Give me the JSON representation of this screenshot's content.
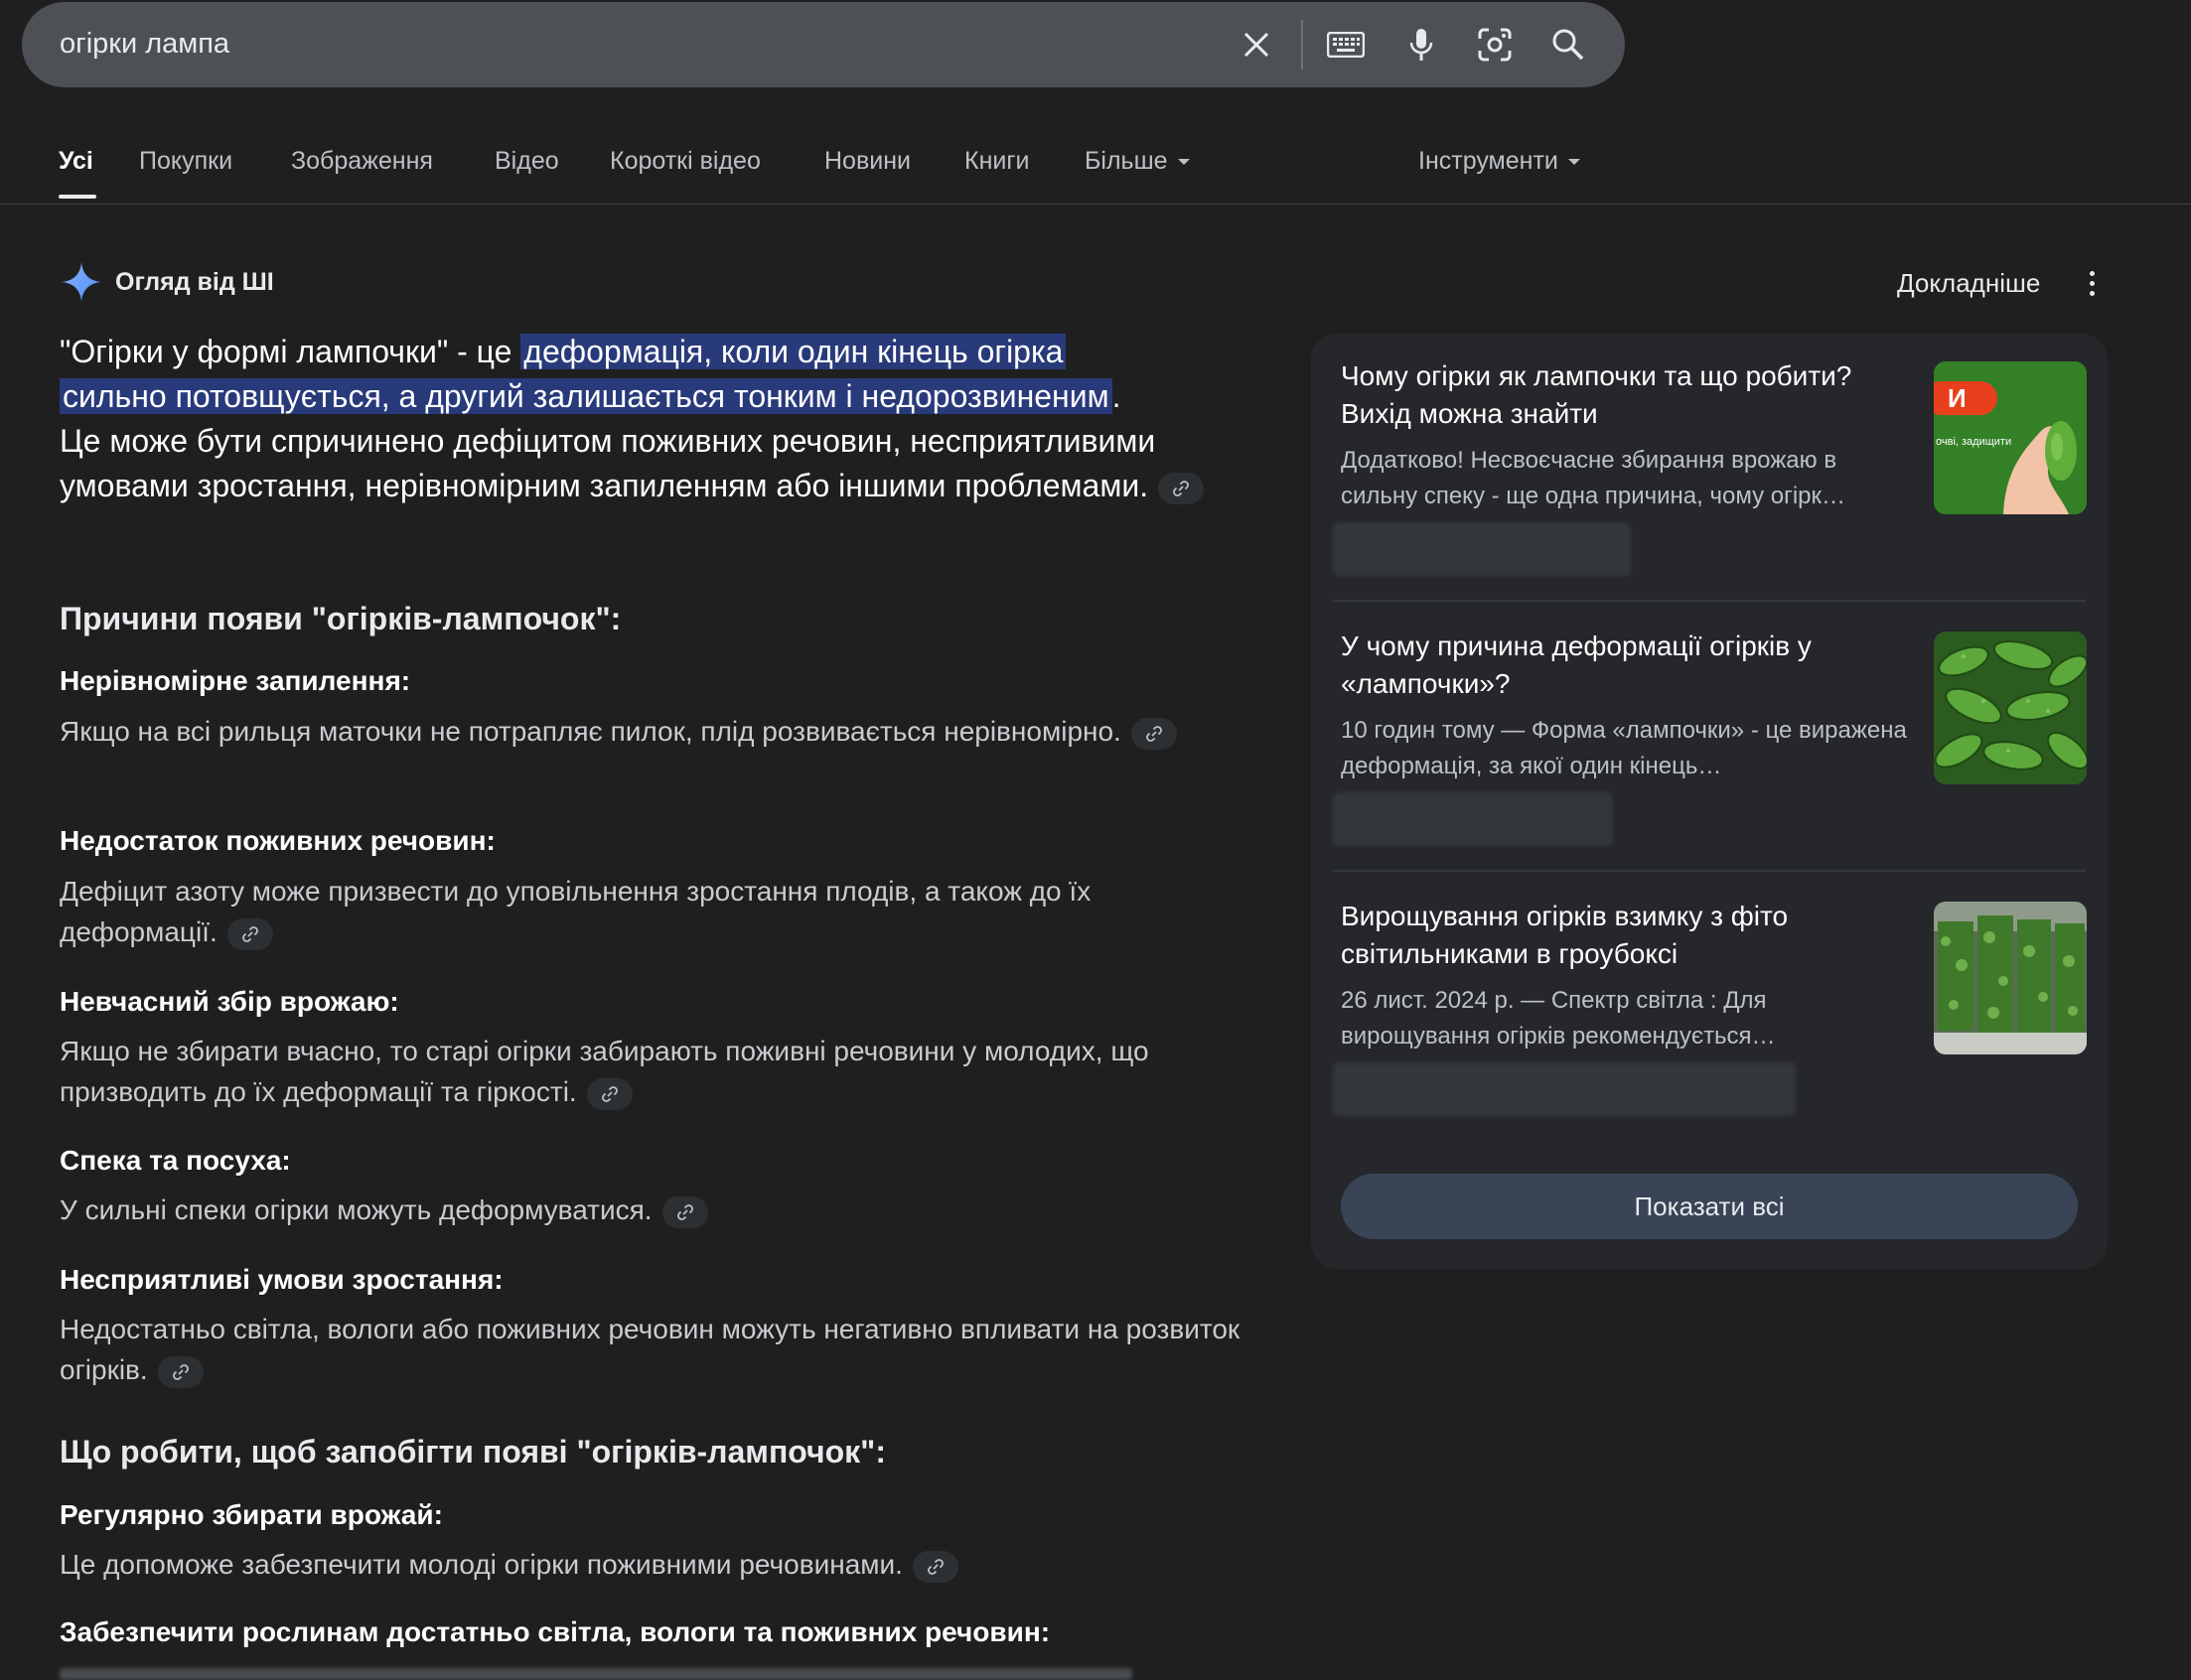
{
  "search": {
    "query": "огірки лампа"
  },
  "icons": {
    "clear": "close-icon",
    "keyboard": "keyboard-icon",
    "voice": "microphone-icon",
    "lens": "lens-icon",
    "search": "search-icon"
  },
  "tabs": [
    {
      "label": "Усі",
      "active": true
    },
    {
      "label": "Покупки"
    },
    {
      "label": "Зображення"
    },
    {
      "label": "Відео"
    },
    {
      "label": "Короткі відео"
    },
    {
      "label": "Новини"
    },
    {
      "label": "Книги"
    },
    {
      "label": "Більше"
    }
  ],
  "tools_label": "Інструменти",
  "ai": {
    "title": "Огляд від ШІ",
    "details_label": "Докладніше",
    "lead_before": "\"Огірки у формі лампочки\" - це ",
    "lead_highlight_1": "деформація, коли один кінець огірка",
    "lead_highlight_2": "сильно потовщується, а другий залишається тонким і недорозвиненим",
    "lead_after": ".",
    "lead_rest": "Це може бути спричинено дефіцитом поживних речовин, несприятливими умовами зростання, нерівномірним запиленням або іншими проблемами.",
    "causes_heading": "Причини появи \"огірків-лампочок\":",
    "causes": [
      {
        "title": "Нерівномірне запилення:",
        "text": "Якщо на всі рильця маточки не потрапляє пилок, плід розвивається нерівномірно."
      },
      {
        "title": "Недостаток поживних речовин:",
        "text": "Дефіцит азоту може призвести до уповільнення зростання плодів, а також до їх деформації."
      },
      {
        "title": "Невчасний збір врожаю:",
        "text": "Якщо не збирати вчасно, то старі огірки забирають поживні речовини у молодих, що призводить до їх деформації та гіркості."
      },
      {
        "title": "Спека та посуха:",
        "text": "У сильні спеки огірки можуть деформуватися."
      },
      {
        "title": "Несприятливі умови зростання:",
        "text": "Недостатньо світла, вологи або поживних речовин можуть негативно впливати на розвиток огірків."
      }
    ],
    "prevent_heading": "Що робити, щоб запобігти появі \"огірків-лампочок\":",
    "prevent": [
      {
        "title": "Регулярно збирати врожай:",
        "text": "Це допоможе забезпечити молоді огірки поживними речовинами."
      },
      {
        "title": "Забезпечити рослинам достатньо світла, вологи та поживних речовин:"
      }
    ]
  },
  "sources": [
    {
      "title": "Чому огірки як лампочки та що робити? Вихід можна знайти",
      "snippet": "Додатково! Несвоєчасне збирання врожаю в сильну спеку - ще одна причина, чому огірк…",
      "thumb_text": "И",
      "thumb_small": "очві, задищити"
    },
    {
      "title": "У чому причина деформації огірків у «лампочки»?",
      "snippet": "10 годин тому — Форма «лампочки» - це виражена деформація, за якої один кінець…"
    },
    {
      "title": "Вирощування огірків взимку з фіто світильниками в гроубоксі",
      "snippet": "26 лист. 2024 р. — Спектр світла : Для вирощування огірків рекомендується…"
    }
  ],
  "show_all_label": "Показати всі",
  "colors": {
    "background": "#1f1f1f",
    "search_bar": "#4d5156",
    "highlight": "#293a7a",
    "panel": "#25272b",
    "show_all_button": "#394457",
    "sparkle": "#4e8cf5"
  }
}
